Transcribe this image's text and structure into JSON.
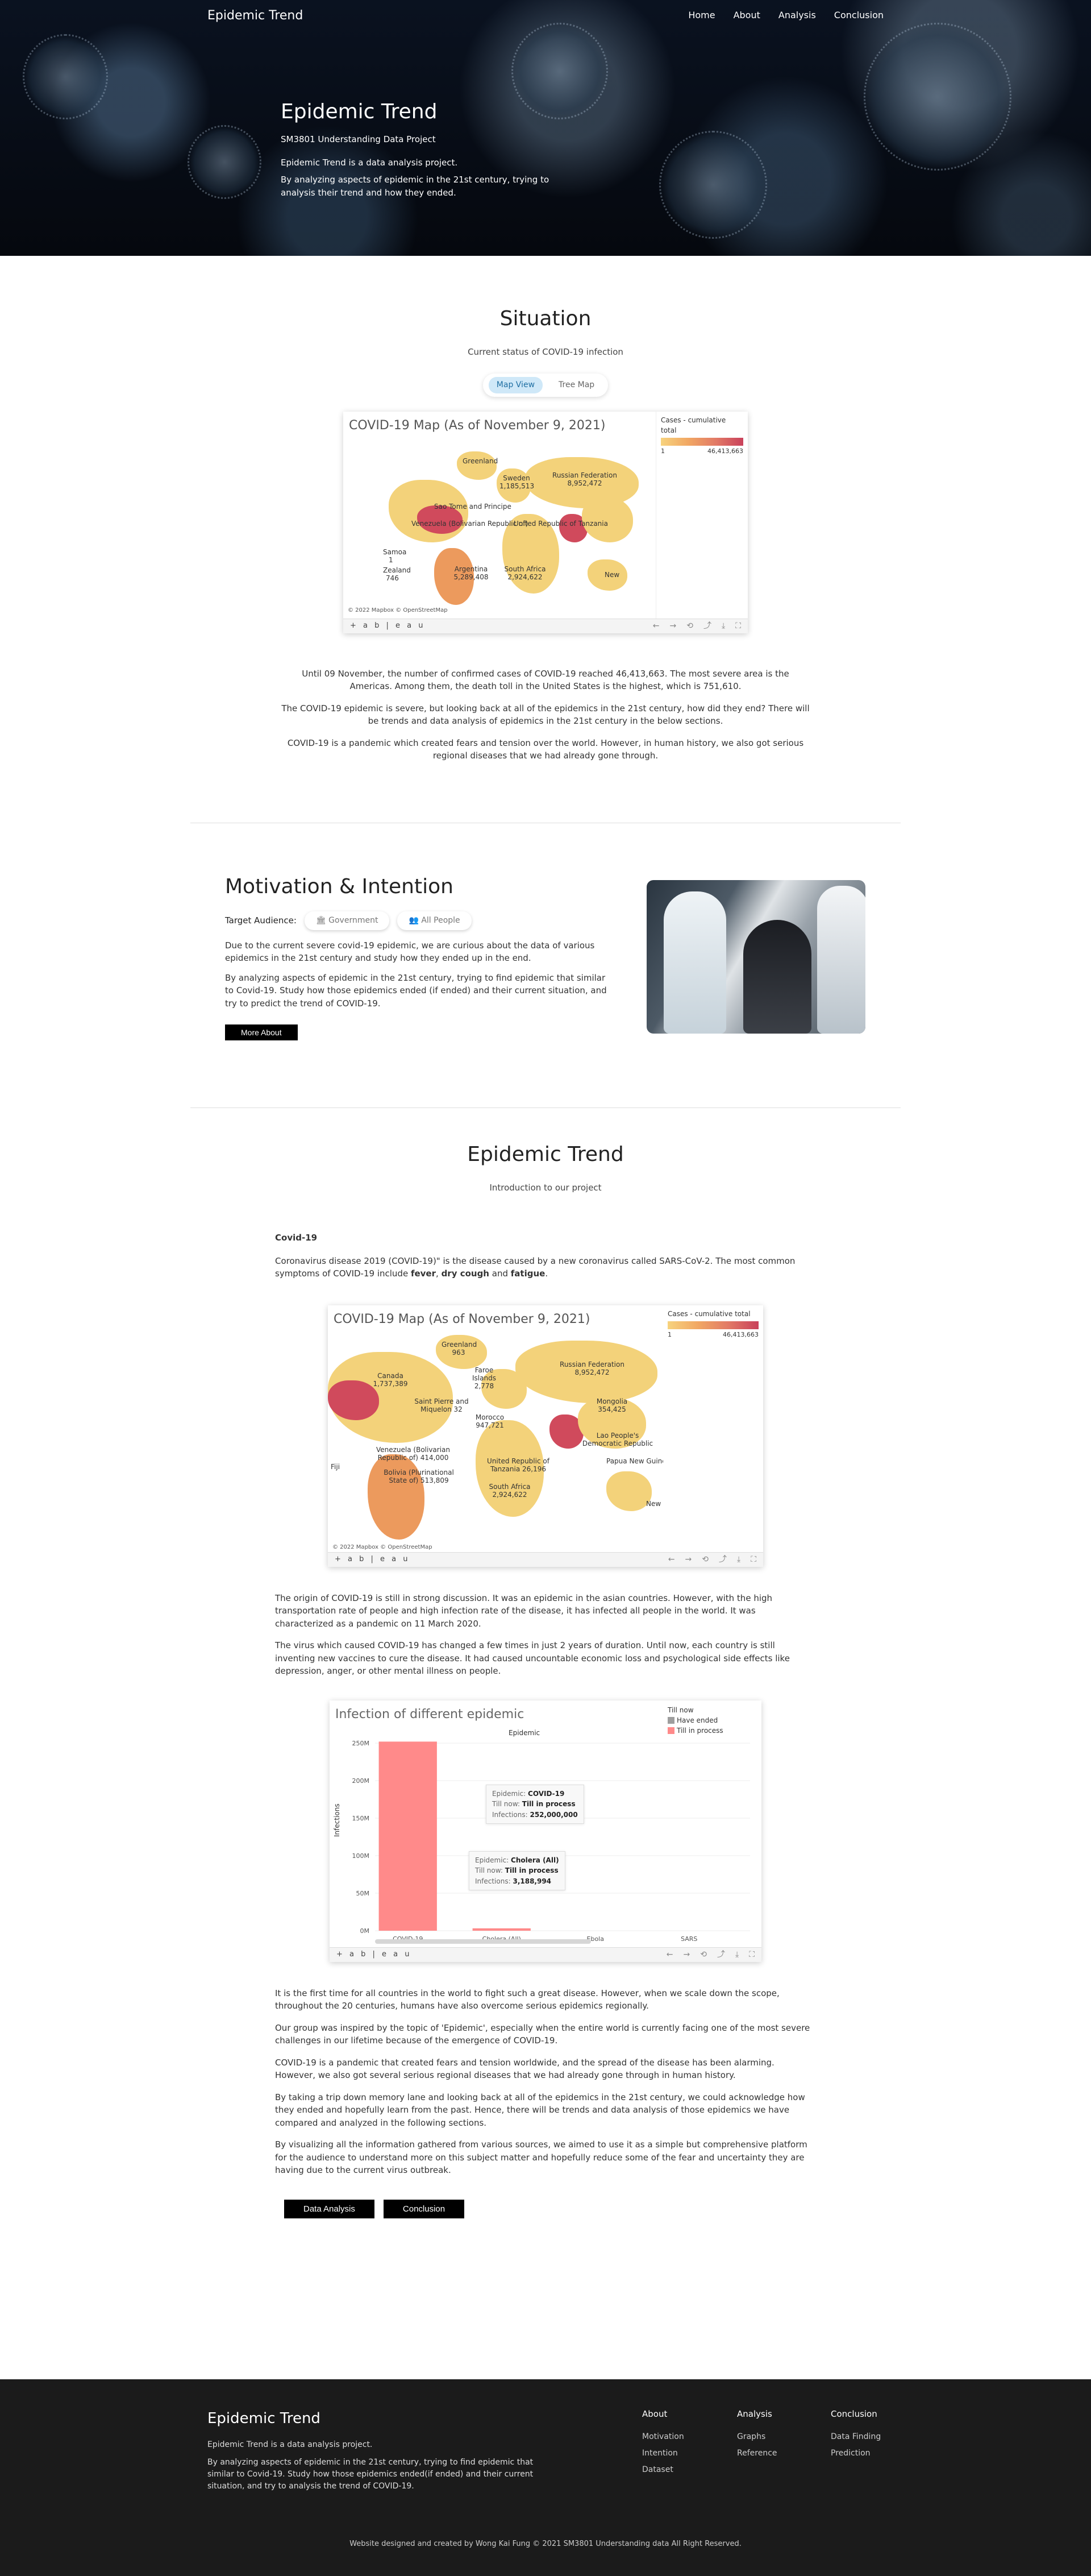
{
  "nav": {
    "brand": "Epidemic Trend",
    "links": [
      "Home",
      "About",
      "Analysis",
      "Conclusion"
    ]
  },
  "hero": {
    "title": "Epidemic Trend",
    "subtitle": "SM3801 Understanding Data Project",
    "para1": "Epidemic Trend is a data analysis project.",
    "para2": "By analyzing aspects of epidemic in the 21st century, trying to analysis their trend and how they ended."
  },
  "situation": {
    "title": "Situation",
    "subtitle": "Current status of COVID-19 infection",
    "toggle": {
      "map": "Map View",
      "tree": "Tree Map"
    },
    "map_title": "COVID-19 Map (As of November 9, 2021)",
    "legend_title": "Cases - cumulative total",
    "legend_min": "1",
    "legend_max": "46,413,663",
    "copyright": "© 2022 Mapbox © OpenStreetMap",
    "tableau_logo": "+ a b | e a u",
    "labels": {
      "greenland": "Greenland",
      "sweden": "Sweden 1,185,513",
      "russia": "Russian Federation 8,952,472",
      "sao_tome": "Sao Tome and Principe",
      "venezuela": "Venezuela (Bolivarian Republic of)",
      "united_rep": "United Republic of Tanzania",
      "argentina": "Argentina 5,289,408",
      "south_africa": "South Africa 2,924,622",
      "samoa": "Samoa",
      "samoa_val": "1",
      "zealand": "Zealand",
      "zealand_val": "746",
      "new": "New"
    },
    "texts": [
      "Until 09 November, the number of confirmed cases of COVID-19 reached 46,413,663. The most severe area is the Americas. Among them, the death toll in the United States is the highest, which is 751,610.",
      "The COVID-19 epidemic is severe, but looking back at all of the epidemics in the 21st century, how did they end? There will be trends and data analysis of epidemics in the 21st century in the below sections.",
      "COVID-19 is a pandemic which created fears and tension over the world. However, in human history, we also got serious regional diseases that we had already gone through."
    ]
  },
  "motivation": {
    "title": "Motivation & Intention",
    "target_label": "Target Audience:",
    "chips": [
      "Government",
      "All People"
    ],
    "para1": "Due to the current severe covid-19 epidemic, we are curious about the data of various epidemics in the 21st century and study how they ended up in the end.",
    "para2": "By analyzing aspects of epidemic in the 21st century, trying to find epidemic that similar to Covid-19. Study how those epidemics ended (if ended) and their current situation, and try to predict the trend of COVID-19.",
    "button": "More About"
  },
  "trend": {
    "title": "Epidemic Trend",
    "subtitle": "Introduction to our project",
    "covid_heading": "Covid-19",
    "intro_pre": "Coronavirus disease 2019 (COVID-19)\" is the disease caused by a new coronavirus called SARS-CoV-2. The most common symptoms of COVID-19 include ",
    "fever": "fever",
    "comma": ", ",
    "dry_cough": "dry cough",
    "and": " and ",
    "fatigue": "fatigue",
    "period": ".",
    "map_title": "COVID-19 Map (As of November 9, 2021)",
    "legend_title": "Cases - cumulative total",
    "legend_min": "1",
    "legend_max": "46,413,663",
    "copyright": "© 2022 Mapbox © OpenStreetMap",
    "labels": {
      "greenland": "Greenland 963",
      "canada": "Canada 1,737,389",
      "faroe": "Faroe Islands 2,778",
      "russia": "Russian Federation 8,952,472",
      "sao_tome": "Saint Pierre and Miquelon 32",
      "mongolia": "Mongolia 354,425",
      "morocco": "Morocco 947,721",
      "venezuela": "Venezuela (Bolivarian Republic of) 414,000",
      "bolivia": "Bolivia (Plurinational State of) 513,809",
      "tanzania": "United Republic of Tanzania 26,196",
      "south_africa": "South Africa 2,924,622",
      "korea": "Lao People's Democratic Republic",
      "papua": "Papua New Guinea",
      "new": "New",
      "fiji": "Fiji"
    },
    "para_origin": "The origin of COVID-19 is still in strong discussion. It was an epidemic in the asian countries. However, with the high transportation rate of people and high infection rate of the disease, it has infected all people in the world. It was characterized as a pandemic on 11 March 2020.",
    "para_virus": "The virus which caused COVID-19 has changed a few times in just 2 years of duration. Until now, each country is still inventing new vaccines to cure the disease. It had caused uncountable economic loss and psychological side effects like depression, anger, or other mental illness on people.",
    "texts": [
      "It is the first time for all countries in the world to fight such a great disease. However, when we scale down the scope, throughout the 20 centuries, humans have also overcome serious epidemics regionally.",
      "Our group was inspired by the topic of 'Epidemic', especially when the entire world is currently facing one of the most severe challenges in our lifetime because of the emergence of COVID-19.",
      "COVID-19 is a pandemic that created fears and tension worldwide, and the spread of the disease has been alarming. However, we also got several serious regional diseases that we had already gone through in human history.",
      "By taking a trip down memory lane and looking back at all of the epidemics in the 21st century, we could acknowledge how they ended and hopefully learn from the past. Hence, there will be trends and data analysis of those epidemics we have compared and analyzed in the following sections.",
      "By visualizing all the information gathered from various sources, we aimed to use it as a simple but comprehensive platform for the audience to understand more on this subject matter and hopefully reduce some of the fear and uncertainty they are having due to the current virus outbreak."
    ],
    "buttons": [
      "Data Analysis",
      "Conclusion"
    ]
  },
  "chart_data": {
    "type": "bar",
    "title": "Infection of different epidemic",
    "column_header": "Epidemic",
    "ylabel": "Infections",
    "categories": [
      "COVID-19",
      "Cholera (All)",
      "Ebola",
      "SARS"
    ],
    "values": [
      252000000,
      3188994,
      0,
      0
    ],
    "yticks": [
      "0M",
      "50M",
      "100M",
      "150M",
      "200M",
      "250M"
    ],
    "ylim": [
      0,
      250000000
    ],
    "legend_title": "Till now",
    "legend": [
      {
        "label": "Have ended",
        "color": "#9e9e9e"
      },
      {
        "label": "Till in process",
        "color": "#ff8a8a"
      }
    ],
    "bar_colors": [
      "#ff8a8a",
      "#ff8a8a",
      "#9e9e9e",
      "#9e9e9e"
    ],
    "tooltips": [
      {
        "epidemic_label": "Epidemic:",
        "epidemic": "COVID-19",
        "tillnow_label": "Till now:",
        "tillnow": "Till in process",
        "inf_label": "Infections:",
        "inf": "252,000,000"
      },
      {
        "epidemic_label": "Epidemic:",
        "epidemic": "Cholera (All)",
        "tillnow_label": "Till now:",
        "tillnow": "Till in process",
        "inf_label": "Infections:",
        "inf": "3,188,994"
      }
    ]
  },
  "footer": {
    "title": "Epidemic Trend",
    "para1": "Epidemic Trend is a data analysis project.",
    "para2": "By analyzing aspects of epidemic in the 21st century, trying to find epidemic that similar to Covid-19. Study how those epidemics ended(if ended) and their current situation, and try to analysis the trend of COVID-19.",
    "cols": [
      {
        "title": "About",
        "links": [
          "Motivation",
          "Intention",
          "Dataset"
        ]
      },
      {
        "title": "Analysis",
        "links": [
          "Graphs",
          "Reference"
        ]
      },
      {
        "title": "Conclusion",
        "links": [
          "Data Finding",
          "Prediction"
        ]
      }
    ],
    "copyright": "Website designed and created by Wong Kai Fung © 2021 SM3801 Understanding data All Right Reserved."
  }
}
